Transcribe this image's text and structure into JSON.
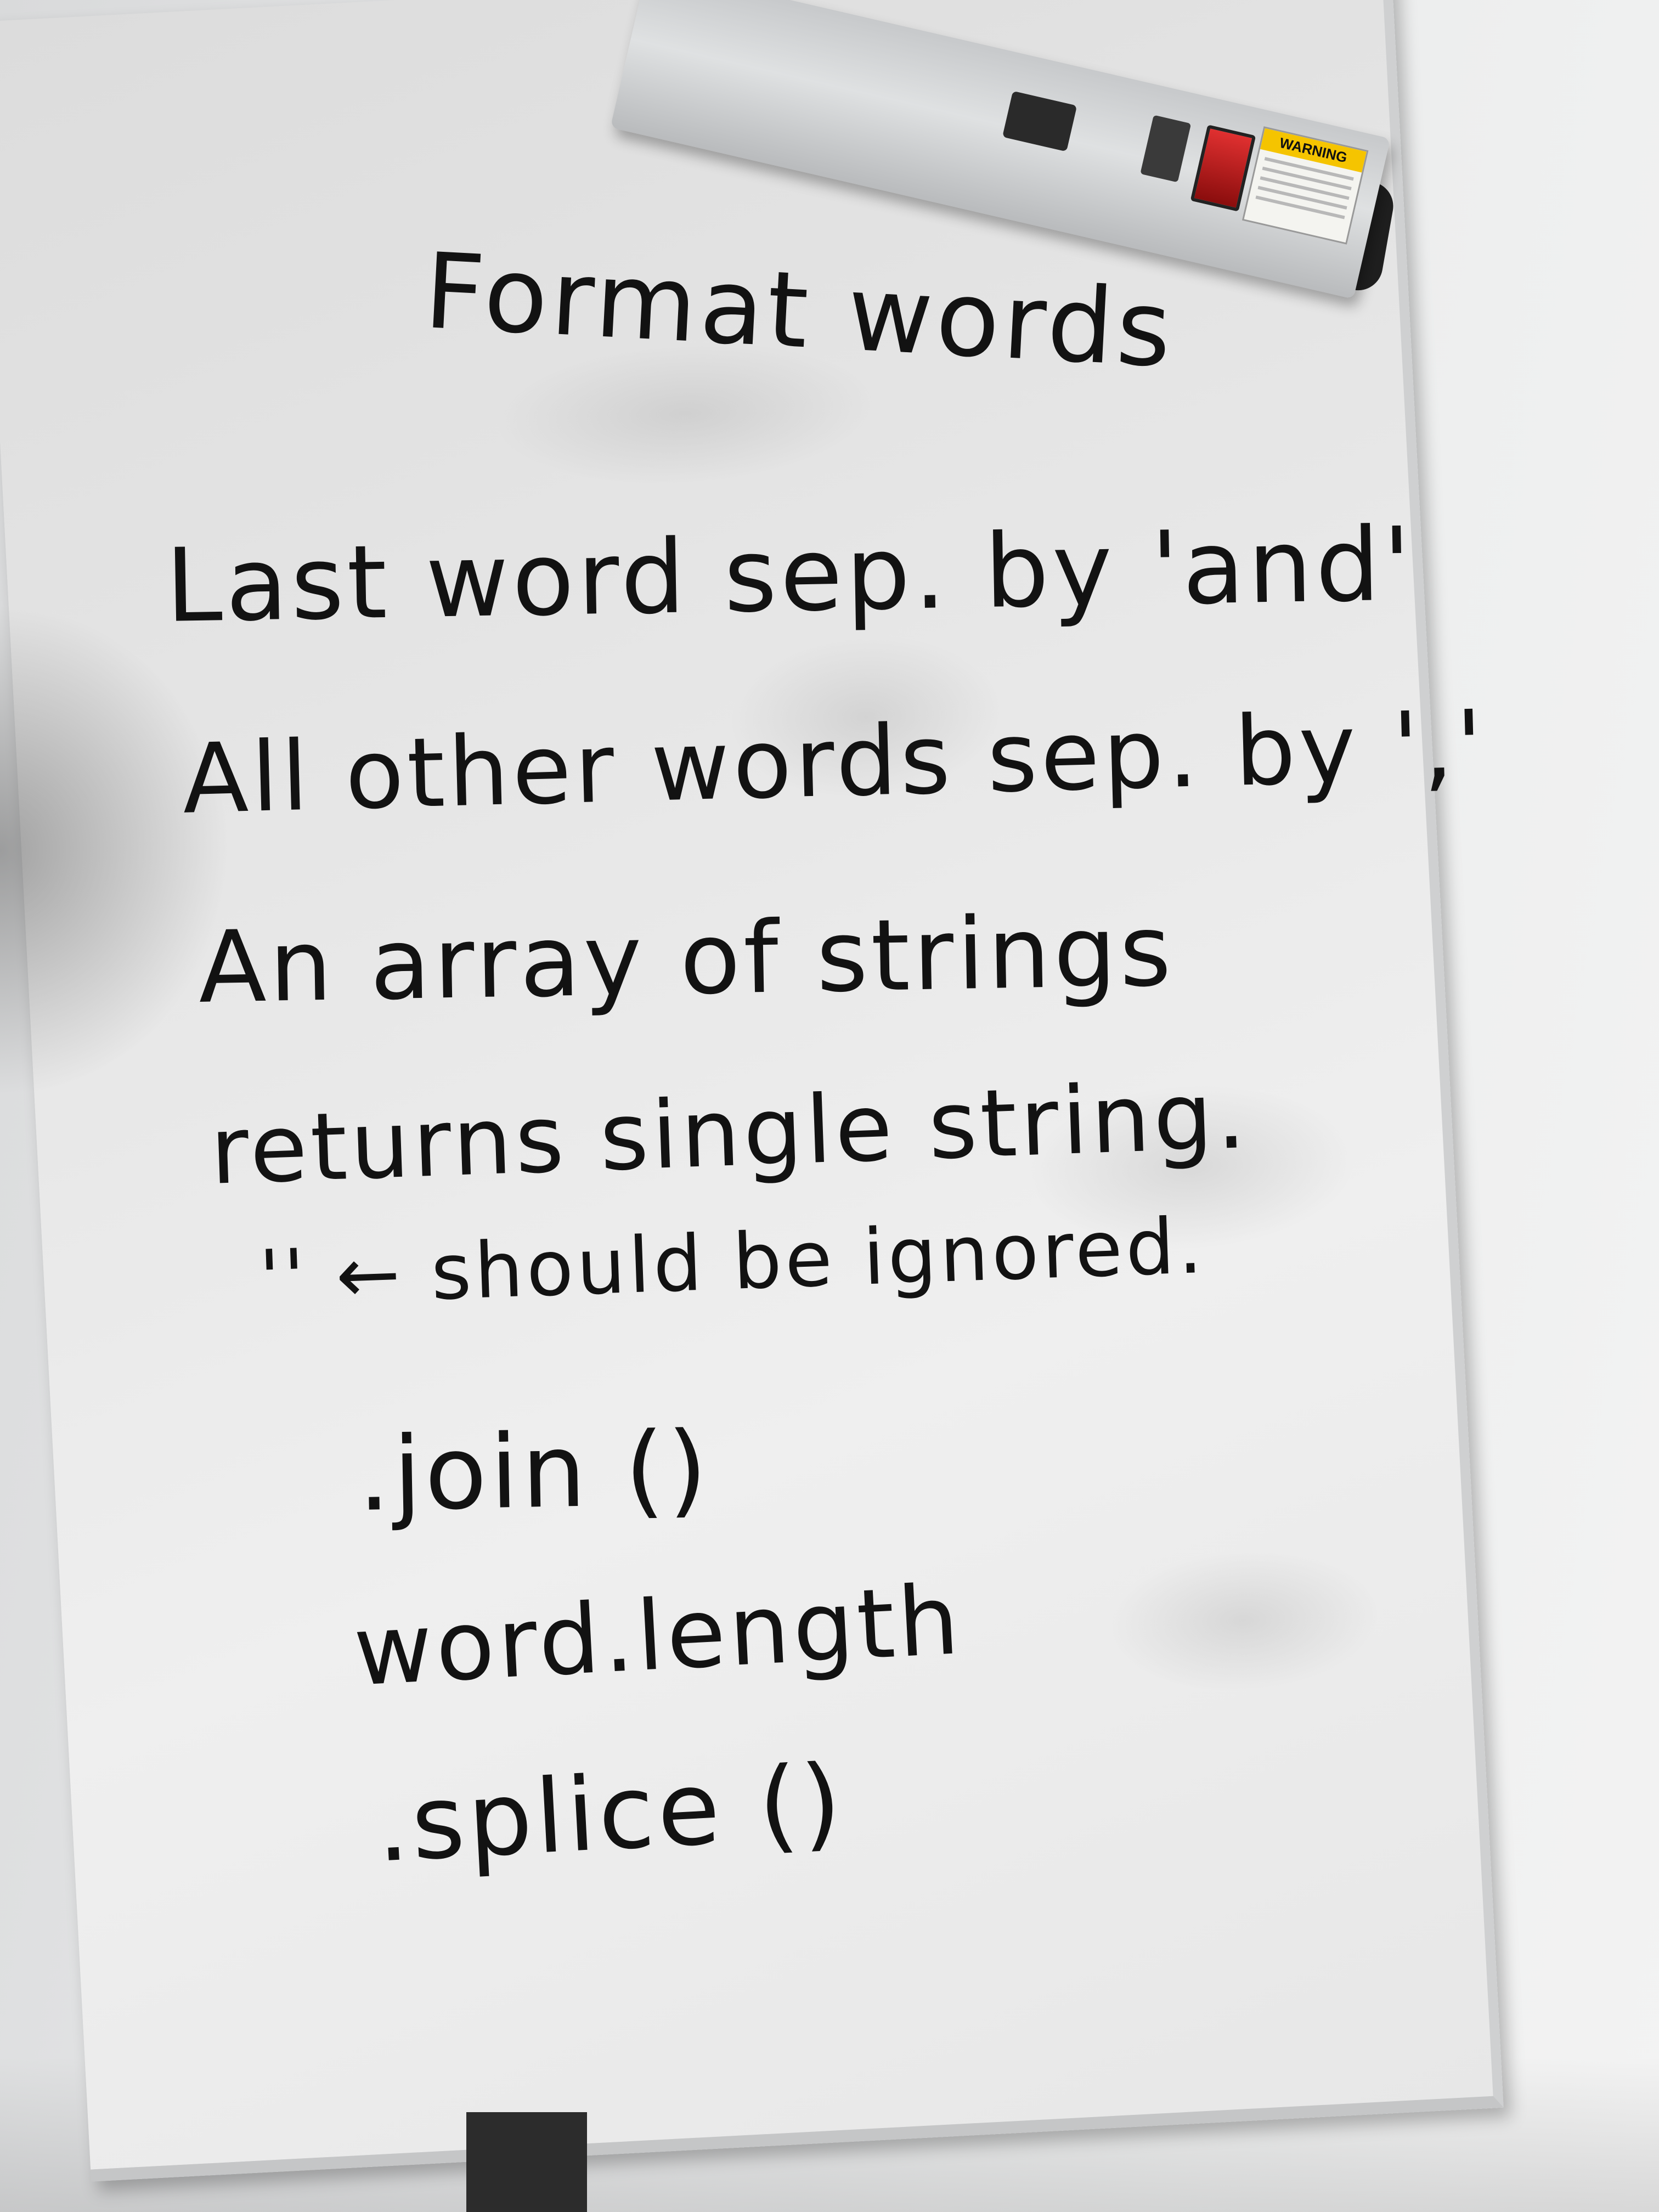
{
  "whiteboard": {
    "title": "Format words",
    "lines": [
      "Last word sep. by 'and'",
      "All other words sep. by ','",
      "An array of strings",
      "returns single string.",
      "'' ← should be ignored.",
      ".join ()",
      "word.length",
      ".splice ()"
    ]
  },
  "power_strip": {
    "warning_label": "WARNING",
    "switch_color": "#d42020"
  },
  "colors": {
    "ink": "#121212",
    "board": "#e6e6e6",
    "wall": "#eeefef"
  }
}
